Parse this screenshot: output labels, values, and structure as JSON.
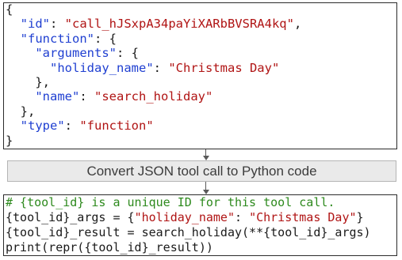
{
  "json_block": {
    "lines": [
      [
        {
          "t": "{",
          "c": "punc"
        }
      ],
      [
        {
          "t": "  ",
          "c": "punc"
        },
        {
          "t": "\"id\"",
          "c": "key"
        },
        {
          "t": ": ",
          "c": "punc"
        },
        {
          "t": "\"call_hJSxpA34paYiXARbBVSRA4kq\"",
          "c": "str"
        },
        {
          "t": ",",
          "c": "punc"
        }
      ],
      [
        {
          "t": "  ",
          "c": "punc"
        },
        {
          "t": "\"function\"",
          "c": "key"
        },
        {
          "t": ": {",
          "c": "punc"
        }
      ],
      [
        {
          "t": "    ",
          "c": "punc"
        },
        {
          "t": "\"arguments\"",
          "c": "key"
        },
        {
          "t": ": {",
          "c": "punc"
        }
      ],
      [
        {
          "t": "      ",
          "c": "punc"
        },
        {
          "t": "\"holiday_name\"",
          "c": "key"
        },
        {
          "t": ": ",
          "c": "punc"
        },
        {
          "t": "\"Christmas Day\"",
          "c": "str"
        }
      ],
      [
        {
          "t": "    },",
          "c": "punc"
        }
      ],
      [
        {
          "t": "    ",
          "c": "punc"
        },
        {
          "t": "\"name\"",
          "c": "key"
        },
        {
          "t": ": ",
          "c": "punc"
        },
        {
          "t": "\"search_holiday\"",
          "c": "str"
        }
      ],
      [
        {
          "t": "  },",
          "c": "punc"
        }
      ],
      [
        {
          "t": "  ",
          "c": "punc"
        },
        {
          "t": "\"type\"",
          "c": "key"
        },
        {
          "t": ": ",
          "c": "punc"
        },
        {
          "t": "\"function\"",
          "c": "str"
        }
      ],
      [
        {
          "t": "}",
          "c": "punc"
        }
      ]
    ]
  },
  "convert_step": {
    "label": "Convert JSON tool call to Python code"
  },
  "python_block": {
    "lines": [
      [
        {
          "t": "# {tool_id} is a unique ID for this tool call.",
          "c": "comment"
        }
      ],
      [
        {
          "t": "{tool_id}_args = {",
          "c": "punc"
        },
        {
          "t": "\"holiday_name\"",
          "c": "pystr"
        },
        {
          "t": ": ",
          "c": "punc"
        },
        {
          "t": "\"Christmas Day\"",
          "c": "pystr"
        },
        {
          "t": "}",
          "c": "punc"
        }
      ],
      [
        {
          "t": "{tool_id}_result = search_holiday(**{tool_id}_args)",
          "c": "punc"
        }
      ],
      [
        {
          "t": "print(repr({tool_id}_result))",
          "c": "punc"
        }
      ]
    ]
  },
  "colors": {
    "json_key": "#1f3fd1",
    "string": "#b01414",
    "comment": "#2e8a1e",
    "text": "#1a1a1a",
    "convert_box_fill": "#eaeaea"
  }
}
